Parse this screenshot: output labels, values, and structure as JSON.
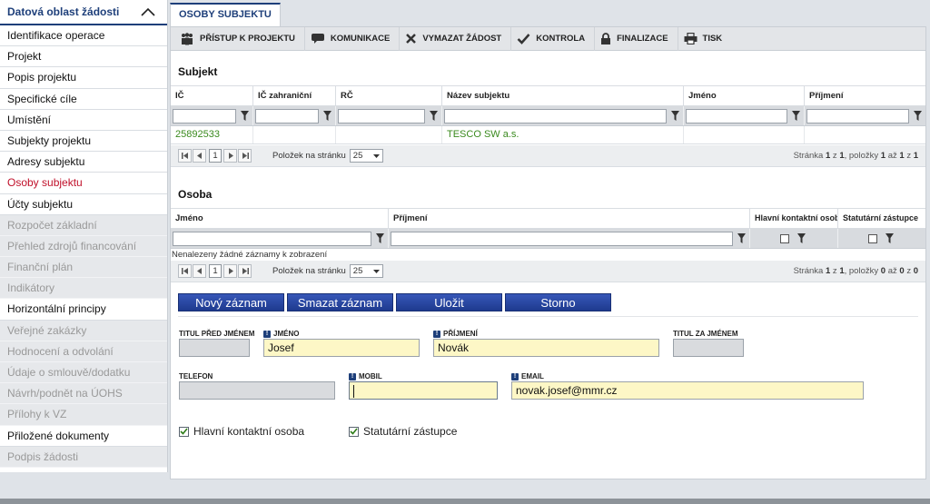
{
  "sidebar": {
    "header": "Datová oblast žádosti",
    "items": [
      {
        "label": "Identifikace operace",
        "state": "normal"
      },
      {
        "label": "Projekt",
        "state": "normal"
      },
      {
        "label": "Popis projektu",
        "state": "normal"
      },
      {
        "label": "Specifické cíle",
        "state": "normal"
      },
      {
        "label": "Umístění",
        "state": "normal"
      },
      {
        "label": "Subjekty projektu",
        "state": "normal"
      },
      {
        "label": "Adresy subjektu",
        "state": "normal"
      },
      {
        "label": "Osoby subjektu",
        "state": "active"
      },
      {
        "label": "Účty subjektu",
        "state": "normal"
      },
      {
        "label": "Rozpočet základní",
        "state": "disabled"
      },
      {
        "label": "Přehled zdrojů financování",
        "state": "disabled"
      },
      {
        "label": "Finanční plán",
        "state": "disabled"
      },
      {
        "label": "Indikátory",
        "state": "disabled"
      },
      {
        "label": "Horizontální principy",
        "state": "normal"
      },
      {
        "label": "Veřejné zakázky",
        "state": "disabled"
      },
      {
        "label": "Hodnocení a odvolání",
        "state": "disabled"
      },
      {
        "label": "Údaje o smlouvě/dodatku",
        "state": "disabled"
      },
      {
        "label": "Návrh/podnět na ÚOHS",
        "state": "disabled"
      },
      {
        "label": "Přílohy k VZ",
        "state": "disabled"
      },
      {
        "label": "Přiložené dokumenty",
        "state": "normal"
      },
      {
        "label": "Podpis žádosti",
        "state": "disabled"
      }
    ]
  },
  "tab": {
    "label": "OSOBY SUBJEKTU"
  },
  "toolbar": {
    "buttons": [
      {
        "label": "PŘÍSTUP K PROJEKTU",
        "icon": "people-icon"
      },
      {
        "label": "KOMUNIKACE",
        "icon": "chat-icon"
      },
      {
        "label": "VYMAZAT ŽÁDOST",
        "icon": "x-icon"
      },
      {
        "label": "KONTROLA",
        "icon": "check-icon"
      },
      {
        "label": "FINALIZACE",
        "icon": "lock-icon"
      },
      {
        "label": "TISK",
        "icon": "printer-icon"
      }
    ]
  },
  "subjekt": {
    "title": "Subjekt",
    "columns": [
      "IČ",
      "IČ zahraniční",
      "RČ",
      "Název subjektu",
      "Jméno",
      "Příjmení"
    ],
    "rows": [
      [
        "25892533",
        "",
        "",
        "TESCO SW a.s.",
        "",
        ""
      ]
    ],
    "pager": {
      "page": "1",
      "per_page_label": "Položek na stránku",
      "per_page": "25",
      "info_prefix": "Stránka",
      "page_cur": "1",
      "of": "z",
      "page_total": "1",
      "items_label": ", položky",
      "item_from": "1",
      "to": "až",
      "item_to": "1",
      "item_total": "1"
    }
  },
  "osoba": {
    "title": "Osoba",
    "columns": [
      "Jméno",
      "Příjmení",
      "Hlavní kontaktní osoba",
      "Statutární zástupce"
    ],
    "empty_text": "Nenalezeny žádné záznamy k zobrazení",
    "pager": {
      "page": "1",
      "per_page_label": "Položek na stránku",
      "per_page": "25",
      "info_prefix": "Stránka",
      "page_cur": "1",
      "of": "z",
      "page_total": "1",
      "items_label": ", položky",
      "item_from": "0",
      "to": "až",
      "item_to": "0",
      "item_total": "0"
    }
  },
  "actions": {
    "new": "Nový záznam",
    "delete": "Smazat záznam",
    "save": "Uložit",
    "cancel": "Storno"
  },
  "form": {
    "titul_pred": {
      "label": "TITUL PŘED JMÉNEM",
      "value": ""
    },
    "jmeno": {
      "label": "JMÉNO",
      "value": "Josef",
      "required": true
    },
    "prijmeni": {
      "label": "PŘÍJMENÍ",
      "value": "Novák",
      "required": true
    },
    "titul_za": {
      "label": "TITUL ZA JMÉNEM",
      "value": ""
    },
    "telefon": {
      "label": "TELEFON",
      "value": ""
    },
    "mobil": {
      "label": "MOBIL",
      "value": "",
      "required": true
    },
    "email": {
      "label": "EMAIL",
      "value": "novak.josef@mmr.cz",
      "required": true
    },
    "hlavni_kontaktni": {
      "label": "Hlavní kontaktní osoba",
      "checked": true
    },
    "statutarni": {
      "label": "Statutární zástupce",
      "checked": true
    }
  },
  "colors": {
    "brand": "#1e3f7a",
    "active": "#c0102a",
    "link_green": "#3a8a1e",
    "required_field": "#fdf7c6"
  }
}
